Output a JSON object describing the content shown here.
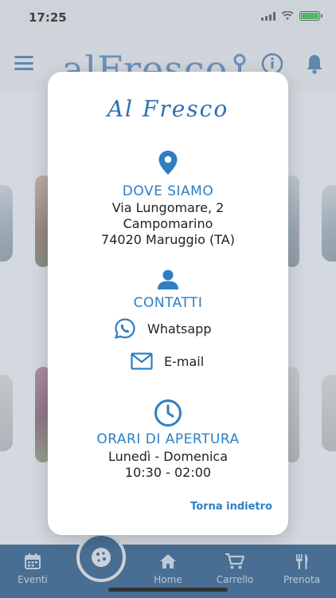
{
  "status_bar": {
    "time": "17:25"
  },
  "header": {
    "brand": "alFresco"
  },
  "modal": {
    "title": "Al Fresco",
    "location": {
      "heading": "DOVE SIAMO",
      "lines": [
        "Via Lungomare, 2",
        "Campomarino",
        "74020 Maruggio (TA)"
      ]
    },
    "contacts": {
      "heading": "CONTATTI",
      "whatsapp_label": "Whatsapp",
      "email_label": "E-mail"
    },
    "hours": {
      "heading": "ORARI DI APERTURA",
      "days": "Lunedì - Domenica",
      "time": "10:30 - 02:00"
    },
    "back_label": "Torna indietro"
  },
  "bottom_nav": {
    "items": [
      {
        "label": "Eventi",
        "icon": "calendar-icon"
      },
      {
        "label": "Home",
        "icon": "home-icon"
      },
      {
        "label": "Carrello",
        "icon": "cart-icon"
      },
      {
        "label": "Prenota",
        "icon": "cutlery-icon"
      }
    ],
    "center_icon": "cookie-icon"
  },
  "colors": {
    "accent": "#2d7fc4",
    "title": "#2d6fb3",
    "nav_bg": "#2e5e8c"
  }
}
